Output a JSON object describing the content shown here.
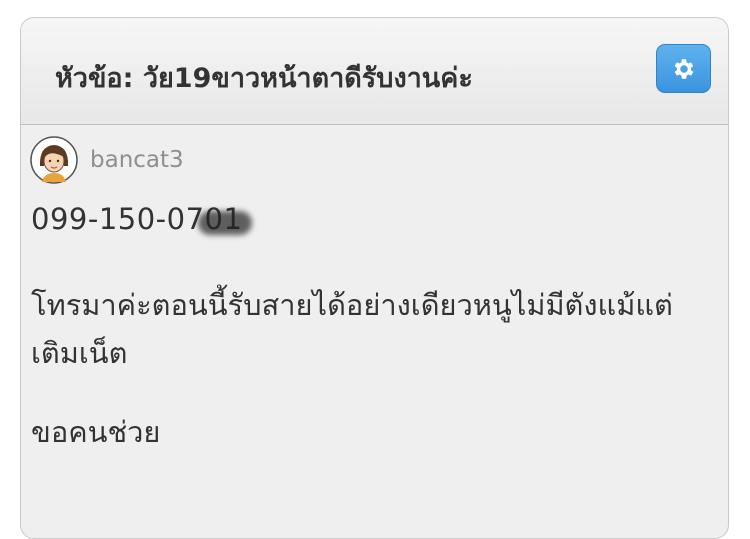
{
  "topic": {
    "title": "หัวข้อ: วัย19ขาวหน้าตาดีรับงานค่ะ",
    "settings_icon": "gear-icon",
    "accent_color": "#4aa3e6"
  },
  "post": {
    "username": "bancat3",
    "avatar_icon": "user-avatar-girl",
    "phone": "099-150-0701",
    "message": "โทรมาค่ะตอนนี้รับสายได้อย่างเดียวหนูไม่มีตังแม้แต่เติมเน็ต",
    "closing": "ขอคนช่วย"
  }
}
